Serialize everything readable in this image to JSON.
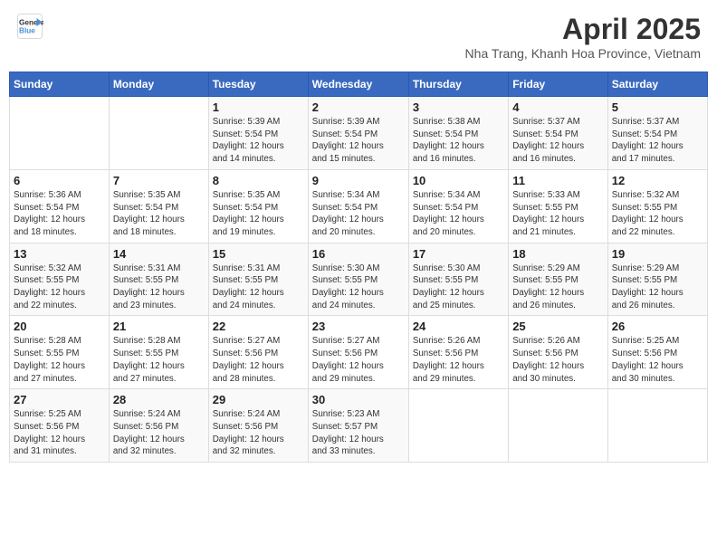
{
  "header": {
    "logo_general": "General",
    "logo_blue": "Blue",
    "month_year": "April 2025",
    "location": "Nha Trang, Khanh Hoa Province, Vietnam"
  },
  "weekdays": [
    "Sunday",
    "Monday",
    "Tuesday",
    "Wednesday",
    "Thursday",
    "Friday",
    "Saturday"
  ],
  "weeks": [
    [
      {
        "day": "",
        "info": ""
      },
      {
        "day": "",
        "info": ""
      },
      {
        "day": "1",
        "info": "Sunrise: 5:39 AM\nSunset: 5:54 PM\nDaylight: 12 hours\nand 14 minutes."
      },
      {
        "day": "2",
        "info": "Sunrise: 5:39 AM\nSunset: 5:54 PM\nDaylight: 12 hours\nand 15 minutes."
      },
      {
        "day": "3",
        "info": "Sunrise: 5:38 AM\nSunset: 5:54 PM\nDaylight: 12 hours\nand 16 minutes."
      },
      {
        "day": "4",
        "info": "Sunrise: 5:37 AM\nSunset: 5:54 PM\nDaylight: 12 hours\nand 16 minutes."
      },
      {
        "day": "5",
        "info": "Sunrise: 5:37 AM\nSunset: 5:54 PM\nDaylight: 12 hours\nand 17 minutes."
      }
    ],
    [
      {
        "day": "6",
        "info": "Sunrise: 5:36 AM\nSunset: 5:54 PM\nDaylight: 12 hours\nand 18 minutes."
      },
      {
        "day": "7",
        "info": "Sunrise: 5:35 AM\nSunset: 5:54 PM\nDaylight: 12 hours\nand 18 minutes."
      },
      {
        "day": "8",
        "info": "Sunrise: 5:35 AM\nSunset: 5:54 PM\nDaylight: 12 hours\nand 19 minutes."
      },
      {
        "day": "9",
        "info": "Sunrise: 5:34 AM\nSunset: 5:54 PM\nDaylight: 12 hours\nand 20 minutes."
      },
      {
        "day": "10",
        "info": "Sunrise: 5:34 AM\nSunset: 5:54 PM\nDaylight: 12 hours\nand 20 minutes."
      },
      {
        "day": "11",
        "info": "Sunrise: 5:33 AM\nSunset: 5:55 PM\nDaylight: 12 hours\nand 21 minutes."
      },
      {
        "day": "12",
        "info": "Sunrise: 5:32 AM\nSunset: 5:55 PM\nDaylight: 12 hours\nand 22 minutes."
      }
    ],
    [
      {
        "day": "13",
        "info": "Sunrise: 5:32 AM\nSunset: 5:55 PM\nDaylight: 12 hours\nand 22 minutes."
      },
      {
        "day": "14",
        "info": "Sunrise: 5:31 AM\nSunset: 5:55 PM\nDaylight: 12 hours\nand 23 minutes."
      },
      {
        "day": "15",
        "info": "Sunrise: 5:31 AM\nSunset: 5:55 PM\nDaylight: 12 hours\nand 24 minutes."
      },
      {
        "day": "16",
        "info": "Sunrise: 5:30 AM\nSunset: 5:55 PM\nDaylight: 12 hours\nand 24 minutes."
      },
      {
        "day": "17",
        "info": "Sunrise: 5:30 AM\nSunset: 5:55 PM\nDaylight: 12 hours\nand 25 minutes."
      },
      {
        "day": "18",
        "info": "Sunrise: 5:29 AM\nSunset: 5:55 PM\nDaylight: 12 hours\nand 26 minutes."
      },
      {
        "day": "19",
        "info": "Sunrise: 5:29 AM\nSunset: 5:55 PM\nDaylight: 12 hours\nand 26 minutes."
      }
    ],
    [
      {
        "day": "20",
        "info": "Sunrise: 5:28 AM\nSunset: 5:55 PM\nDaylight: 12 hours\nand 27 minutes."
      },
      {
        "day": "21",
        "info": "Sunrise: 5:28 AM\nSunset: 5:55 PM\nDaylight: 12 hours\nand 27 minutes."
      },
      {
        "day": "22",
        "info": "Sunrise: 5:27 AM\nSunset: 5:56 PM\nDaylight: 12 hours\nand 28 minutes."
      },
      {
        "day": "23",
        "info": "Sunrise: 5:27 AM\nSunset: 5:56 PM\nDaylight: 12 hours\nand 29 minutes."
      },
      {
        "day": "24",
        "info": "Sunrise: 5:26 AM\nSunset: 5:56 PM\nDaylight: 12 hours\nand 29 minutes."
      },
      {
        "day": "25",
        "info": "Sunrise: 5:26 AM\nSunset: 5:56 PM\nDaylight: 12 hours\nand 30 minutes."
      },
      {
        "day": "26",
        "info": "Sunrise: 5:25 AM\nSunset: 5:56 PM\nDaylight: 12 hours\nand 30 minutes."
      }
    ],
    [
      {
        "day": "27",
        "info": "Sunrise: 5:25 AM\nSunset: 5:56 PM\nDaylight: 12 hours\nand 31 minutes."
      },
      {
        "day": "28",
        "info": "Sunrise: 5:24 AM\nSunset: 5:56 PM\nDaylight: 12 hours\nand 32 minutes."
      },
      {
        "day": "29",
        "info": "Sunrise: 5:24 AM\nSunset: 5:56 PM\nDaylight: 12 hours\nand 32 minutes."
      },
      {
        "day": "30",
        "info": "Sunrise: 5:23 AM\nSunset: 5:57 PM\nDaylight: 12 hours\nand 33 minutes."
      },
      {
        "day": "",
        "info": ""
      },
      {
        "day": "",
        "info": ""
      },
      {
        "day": "",
        "info": ""
      }
    ]
  ]
}
